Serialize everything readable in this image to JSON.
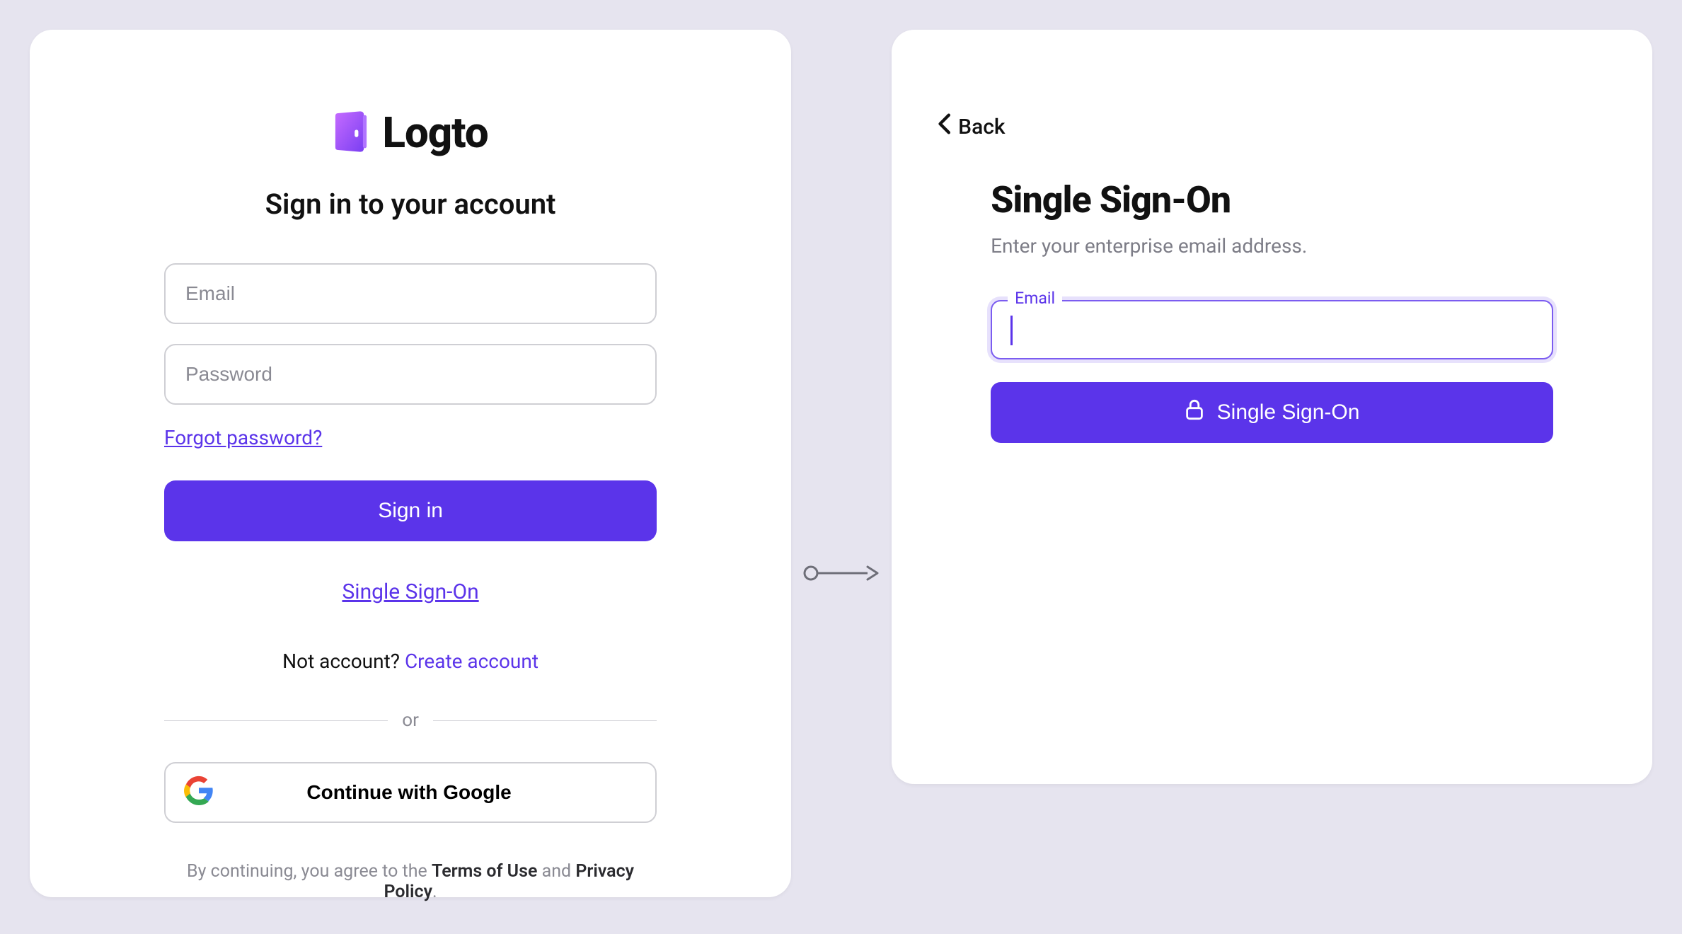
{
  "brand": {
    "name": "Logto"
  },
  "left": {
    "title": "Sign in to your account",
    "email_placeholder": "Email",
    "password_placeholder": "Password",
    "forgot": "Forgot password?",
    "signin": "Sign in",
    "sso_link": "Single Sign-On",
    "no_account": "Not account? ",
    "create": "Create account",
    "divider": "or",
    "google": "Continue with Google",
    "legal_prefix": "By continuing, you agree to the ",
    "legal_tou": "Terms of Use",
    "legal_mid": " and ",
    "legal_pp": "Privacy Policy",
    "legal_suffix": "."
  },
  "right": {
    "back": "Back",
    "title": "Single Sign-On",
    "subtitle": "Enter your enterprise email address.",
    "email_label": "Email",
    "button": "Single Sign-On"
  },
  "colors": {
    "accent": "#5b34ea"
  }
}
